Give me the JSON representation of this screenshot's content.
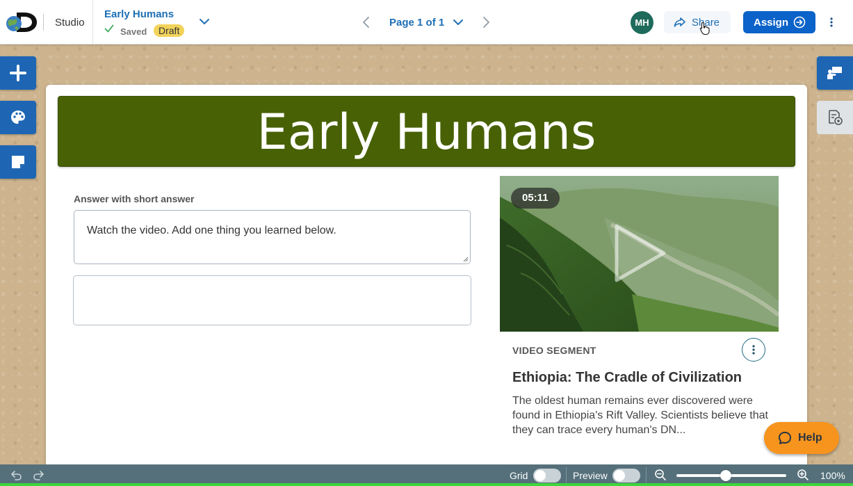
{
  "header": {
    "app_name": "Studio",
    "doc_title": "Early Humans",
    "saved_label": "Saved",
    "status_badge": "Draft",
    "page_label": "Page 1 of 1",
    "avatar_initials": "MH",
    "share_label": "Share",
    "assign_label": "Assign"
  },
  "canvas": {
    "banner_title": "Early Humans",
    "question_label": "Answer with short answer",
    "prompt_text": "Watch the video. Add one thing you learned below.",
    "answer_value": ""
  },
  "video": {
    "duration": "05:11",
    "segment_label": "VIDEO SEGMENT",
    "title": "Ethiopia: The Cradle of Civilization",
    "description": "The oldest human remains ever discovered were found in Ethiopia's Rift Valley. Scientists believe that they can trace every human's DN..."
  },
  "help": {
    "label": "Help"
  },
  "footer": {
    "grid_label": "Grid",
    "grid_on": false,
    "preview_label": "Preview",
    "preview_on": false,
    "zoom_value": "100%",
    "zoom_fraction": 0.45
  },
  "colors": {
    "brand_blue": "#0b62c8",
    "link_blue": "#1d6fb5",
    "banner_green": "#476104",
    "draft_yellow": "#f1d35b",
    "help_orange": "#f7941d",
    "avatar_teal": "#1e6b5b"
  }
}
